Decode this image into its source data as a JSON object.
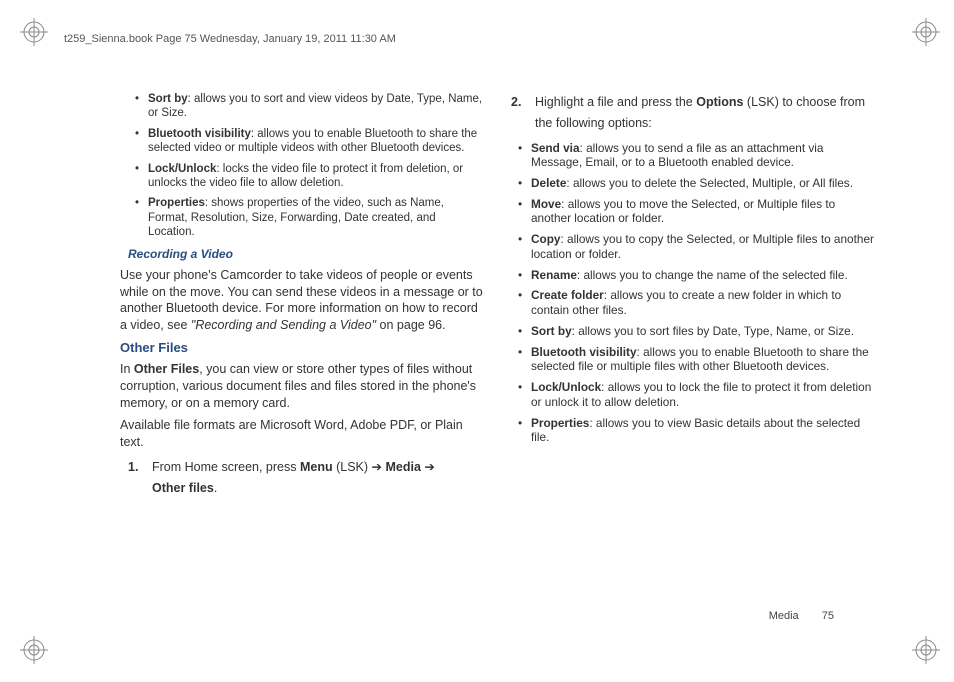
{
  "meta": {
    "header": "t259_Sienna.book  Page 75  Wednesday, January 19, 2011  11:30 AM"
  },
  "left": {
    "bullets": [
      {
        "term": "Sort by",
        "desc": ": allows you to sort and view videos by Date, Type, Name, or Size."
      },
      {
        "term": "Bluetooth visibility",
        "desc": ": allows you to enable Bluetooth to share the selected video or multiple videos with other Bluetooth devices."
      },
      {
        "term": "Lock/Unlock",
        "desc": ": locks the video file to protect it from deletion, or unlocks the video file to allow deletion."
      },
      {
        "term": "Properties",
        "desc": ": shows properties of the video, such as Name, Format, Resolution, Size, Forwarding, Date created, and Location."
      }
    ],
    "subhead": "Recording a Video",
    "recording_para_pre": "Use your phone's Camcorder to take videos of people or events while on the move. You can send these videos in a message or to another Bluetooth device. For more information on how to record a video, see ",
    "recording_para_ital": "\"Recording and Sending a Video\"",
    "recording_para_post": " on page 96.",
    "section": "Other Files",
    "other_para1_pre": "In ",
    "other_para1_bold": "Other Files",
    "other_para1_post": ", you can view or store other types of files without corruption, various document files and files stored in the phone's memory, or on a memory card.",
    "other_para2": "Available file formats are Microsoft Word, Adobe PDF, or Plain text.",
    "step1_num": "1.",
    "step1_pre": "From Home screen, press ",
    "step1_menu": "Menu",
    "step1_lsk": " (LSK) ",
    "step1_arrow": "➔",
    "step1_media": " Media ",
    "step1_other": "Other files",
    "step1_period": "."
  },
  "right": {
    "step2_num": "2.",
    "step2_pre": "Highlight a file and press the ",
    "step2_opt": "Options",
    "step2_post": " (LSK) to choose from the following options:",
    "bullets": [
      {
        "term": "Send via",
        "desc": ": allows you to send a file as an attachment via Message, Email, or to a Bluetooth enabled device."
      },
      {
        "term": "Delete",
        "desc": ": allows you to delete the Selected, Multiple, or All files."
      },
      {
        "term": "Move",
        "desc": ": allows you to move the Selected, or Multiple files to another location or folder."
      },
      {
        "term": "Copy",
        "desc": ": allows you to copy the Selected, or Multiple files to another location or folder."
      },
      {
        "term": "Rename",
        "desc": ": allows you to change the name of the selected file."
      },
      {
        "term": "Create folder",
        "desc": ": allows you to create a new folder in which to contain other files."
      },
      {
        "term": "Sort by",
        "desc": ": allows you to sort files by Date, Type, Name, or Size."
      },
      {
        "term": "Bluetooth visibility",
        "desc": ": allows you to enable Bluetooth to share the selected file or multiple files with other Bluetooth devices."
      },
      {
        "term": "Lock/Unlock",
        "desc": ": allows you to lock the file to protect it from deletion or unlock it to allow deletion."
      },
      {
        "term": "Properties",
        "desc": ": allows you to view Basic details about the selected file."
      }
    ]
  },
  "footer": {
    "section": "Media",
    "page": "75"
  }
}
